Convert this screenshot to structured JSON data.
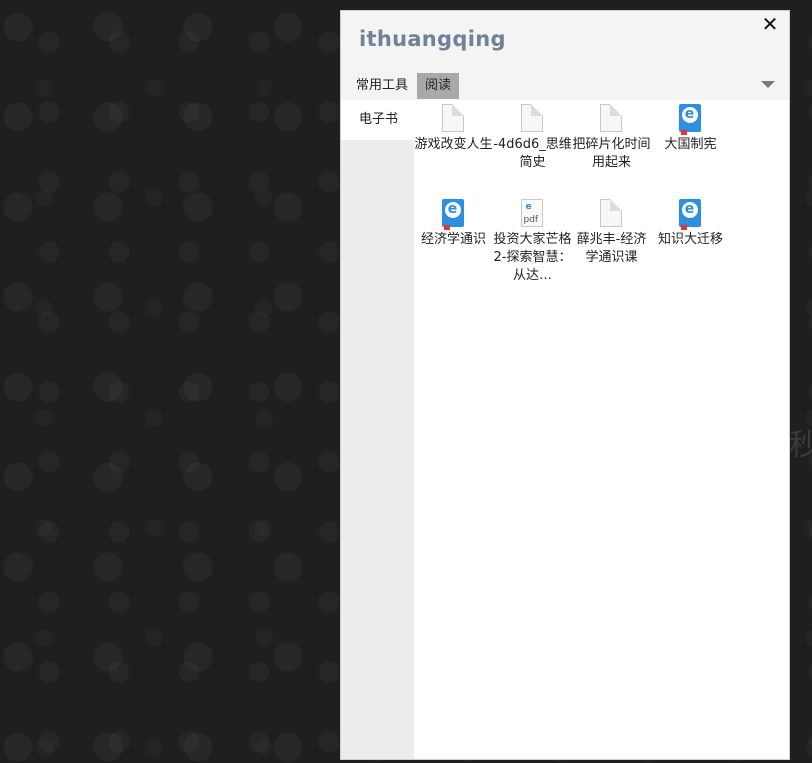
{
  "background": {
    "partial_char": "秒"
  },
  "panel": {
    "title": "ithuangqing",
    "close_label": "✕",
    "tabs": [
      {
        "label": "常用工具",
        "active": false
      },
      {
        "label": "阅读",
        "active": true
      }
    ],
    "sidebar": {
      "items": [
        {
          "label": "电子书",
          "active": true
        }
      ]
    },
    "files": [
      {
        "name": "游戏改变人生",
        "icon": "document-icon"
      },
      {
        "name": "-4d6d6_思维简史",
        "icon": "document-icon"
      },
      {
        "name": "把碎片化时间用起来",
        "icon": "document-icon"
      },
      {
        "name": "大国制宪",
        "icon": "ebook-icon"
      },
      {
        "name": "经济学通识",
        "icon": "ebook-icon"
      },
      {
        "name": "投资大家芒格2-探索智慧：从达…",
        "icon": "pdf-icon"
      },
      {
        "name": "薛兆丰-经济学通识课",
        "icon": "document-icon"
      },
      {
        "name": "知识大迁移",
        "icon": "ebook-icon"
      }
    ]
  },
  "colors": {
    "accent_title": "#6f8296",
    "ebook_blue": "#2d8fe0",
    "bookmark_red": "#e0353a",
    "active_tab": "#a9a9a9"
  }
}
